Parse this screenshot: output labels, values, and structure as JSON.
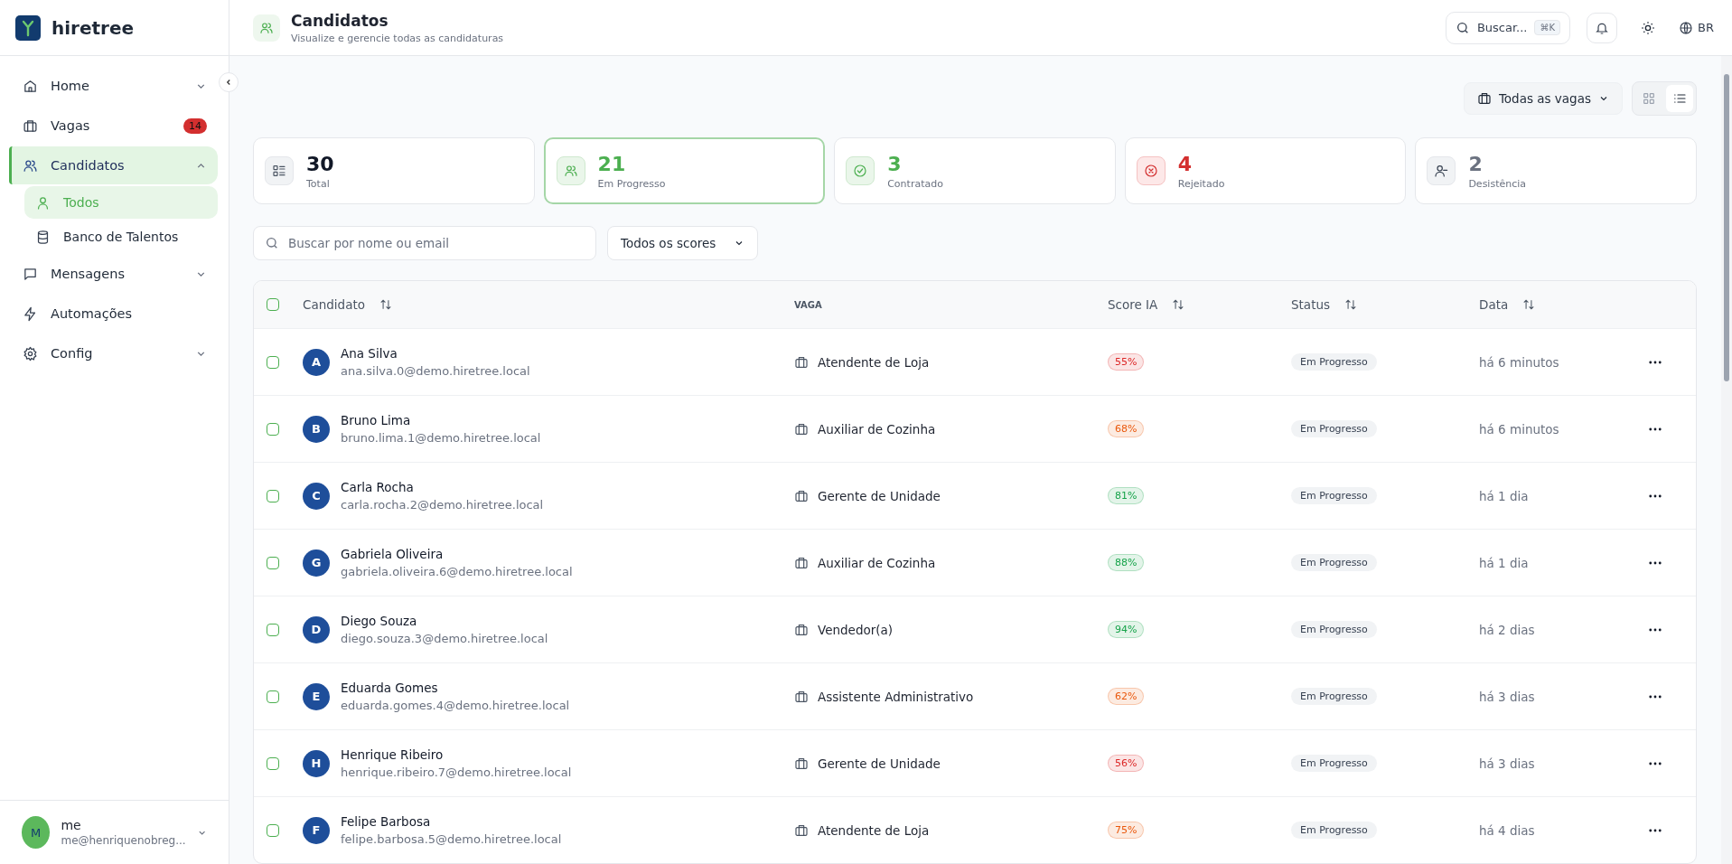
{
  "brand": {
    "name": "hiretree"
  },
  "sidebar": {
    "items": [
      {
        "label": "Home",
        "kind": "home",
        "selected": false,
        "expanded": false
      },
      {
        "label": "Vagas",
        "kind": "briefcase",
        "selected": false,
        "badge": "14"
      },
      {
        "label": "Candidatos",
        "kind": "users",
        "selected": true,
        "expanded": true,
        "children": [
          {
            "label": "Todos",
            "kind": "user",
            "selected": true
          },
          {
            "label": "Banco de Talentos",
            "kind": "database",
            "selected": false
          }
        ]
      },
      {
        "label": "Mensagens",
        "kind": "message",
        "selected": false,
        "expanded": false
      },
      {
        "label": "Automações",
        "kind": "zap",
        "selected": false
      },
      {
        "label": "Config",
        "kind": "gear",
        "selected": false,
        "expanded": false
      }
    ],
    "user": {
      "initial": "M",
      "name": "me",
      "email": "me@henriquenobreg..."
    }
  },
  "header": {
    "title": "Candidatos",
    "subtitle": "Visualize e gerencie todas as candidaturas",
    "search": {
      "placeholder": "Buscar...",
      "shortcut": "⌘K"
    },
    "language": "BR"
  },
  "toolbar": {
    "job_filter": "Todas as vagas",
    "view_toggle": [
      {
        "kind": "grid",
        "selected": false
      },
      {
        "kind": "list",
        "selected": true
      }
    ]
  },
  "stats": [
    {
      "kind": "total",
      "value": "30",
      "label": "Total",
      "selected": false
    },
    {
      "kind": "progress",
      "value": "21",
      "label": "Em Progresso",
      "selected": true
    },
    {
      "kind": "hired",
      "value": "3",
      "label": "Contratado",
      "selected": false
    },
    {
      "kind": "rejected",
      "value": "4",
      "label": "Rejeitado",
      "selected": false
    },
    {
      "kind": "withdrawn",
      "value": "2",
      "label": "Desistência",
      "selected": false
    }
  ],
  "filters": {
    "search": {
      "placeholder": "Buscar por nome ou email"
    },
    "score_filter": "Todos os scores"
  },
  "table": {
    "select_all": {
      "checked": false
    },
    "columns": [
      {
        "label": "Candidato",
        "sortable": true
      },
      {
        "label": "VAGA",
        "sortable": false
      },
      {
        "label": "Score IA",
        "sortable": true
      },
      {
        "label": "Status",
        "sortable": true
      },
      {
        "label": "Data",
        "sortable": true
      }
    ],
    "rows": [
      {
        "checked": false,
        "initial": "A",
        "name": "Ana Silva",
        "email": "ana.silva.0@demo.hiretree.local",
        "job": "Atendente de Loja",
        "score": "55%",
        "color": "#dc2626",
        "status": "Em Progresso",
        "date": "há 6 minutos"
      },
      {
        "checked": false,
        "initial": "B",
        "name": "Bruno Lima",
        "email": "bruno.lima.1@demo.hiretree.local",
        "job": "Auxiliar de Cozinha",
        "score": "68%",
        "color": "#ea580c",
        "status": "Em Progresso",
        "date": "há 6 minutos"
      },
      {
        "checked": false,
        "initial": "C",
        "name": "Carla Rocha",
        "email": "carla.rocha.2@demo.hiretree.local",
        "job": "Gerente de Unidade",
        "score": "81%",
        "color": "#16a34a",
        "status": "Em Progresso",
        "date": "há 1 dia"
      },
      {
        "checked": false,
        "initial": "G",
        "name": "Gabriela Oliveira",
        "email": "gabriela.oliveira.6@demo.hiretree.local",
        "job": "Auxiliar de Cozinha",
        "score": "88%",
        "color": "#16a34a",
        "status": "Em Progresso",
        "date": "há 1 dia"
      },
      {
        "checked": false,
        "initial": "D",
        "name": "Diego Souza",
        "email": "diego.souza.3@demo.hiretree.local",
        "job": "Vendedor(a)",
        "score": "94%",
        "color": "#16a34a",
        "status": "Em Progresso",
        "date": "há 2 dias"
      },
      {
        "checked": false,
        "initial": "E",
        "name": "Eduarda Gomes",
        "email": "eduarda.gomes.4@demo.hiretree.local",
        "job": "Assistente Administrativo",
        "score": "62%",
        "color": "#ea580c",
        "status": "Em Progresso",
        "date": "há 3 dias"
      },
      {
        "checked": false,
        "initial": "H",
        "name": "Henrique Ribeiro",
        "email": "henrique.ribeiro.7@demo.hiretree.local",
        "job": "Gerente de Unidade",
        "score": "56%",
        "color": "#dc2626",
        "status": "Em Progresso",
        "date": "há 3 dias"
      },
      {
        "checked": false,
        "initial": "F",
        "name": "Felipe Barbosa",
        "email": "felipe.barbosa.5@demo.hiretree.local",
        "job": "Atendente de Loja",
        "score": "75%",
        "color": "#ea580c",
        "status": "Em Progresso",
        "date": "há 4 dias"
      }
    ]
  }
}
